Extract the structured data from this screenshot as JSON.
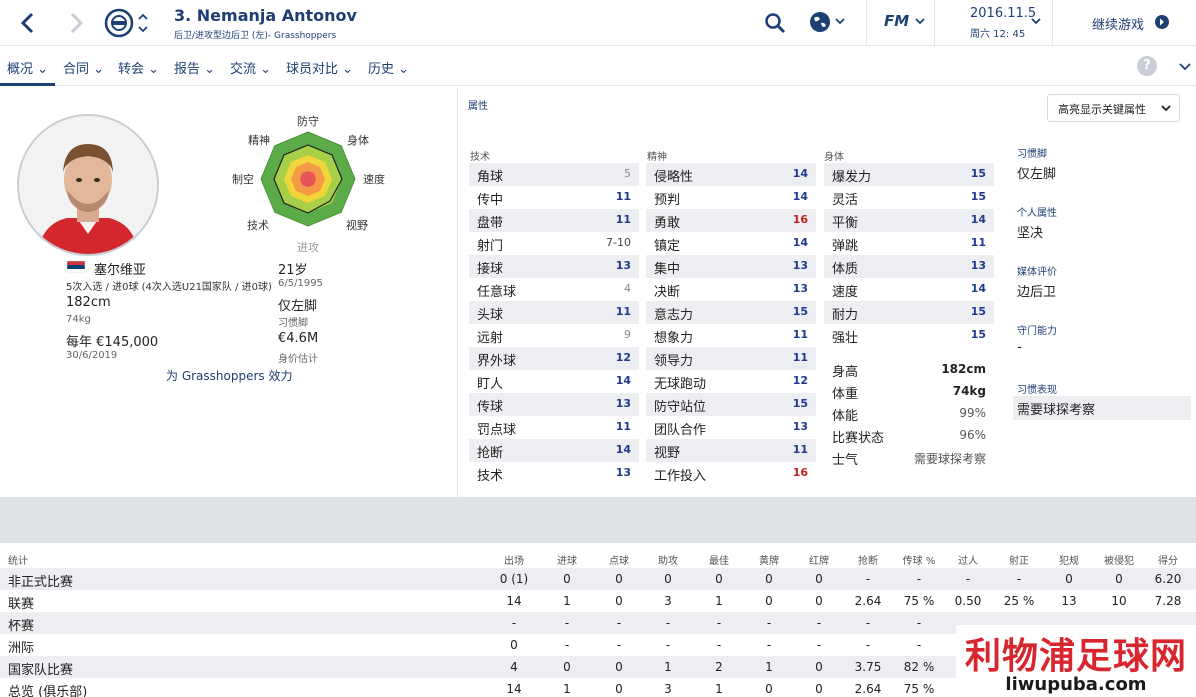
{
  "header": {
    "player_name": "3. Nemanja Antonov",
    "subtitle": "后卫/进攻型边后卫 (左)- Grasshoppers",
    "game_logo": "FM",
    "date": "2016.11.5",
    "time": "周六 12: 45",
    "continue_label": "继续游戏"
  },
  "nav": {
    "tabs": [
      "概况",
      "合同",
      "转会",
      "报告",
      "交流",
      "球员对比",
      "历史"
    ],
    "help": "?"
  },
  "profile": {
    "nationality": "塞尔维亚",
    "caps": "5次入选 / 进0球 (4次入选U21国家队 / 进0球)",
    "age": "21岁",
    "dob": "6/5/1995",
    "height": "182cm",
    "weight": "74kg",
    "foot": "仅左脚",
    "foot_label": "习惯脚",
    "wage": "每年 €145,000",
    "contract_end": "30/6/2019",
    "value": "€4.6M",
    "value_label": "身价估计",
    "club_line": "为 Grasshoppers 效力"
  },
  "radar": {
    "labels": [
      "防守",
      "身体",
      "速度",
      "视野",
      "进攻",
      "技术",
      "制空",
      "精神"
    ]
  },
  "attributes": {
    "section_title": "属性",
    "highlight_select": "高亮显示关键属性",
    "technical_title": "技术",
    "mental_title": "精神",
    "physical_title": "身体",
    "technical": [
      {
        "name": "角球",
        "value": "5",
        "tone": "grey"
      },
      {
        "name": "传中",
        "value": "11",
        "tone": "blue"
      },
      {
        "name": "盘带",
        "value": "11",
        "tone": "blue"
      },
      {
        "name": "射门",
        "value": "7-10",
        "tone": "plain"
      },
      {
        "name": "接球",
        "value": "13",
        "tone": "blue"
      },
      {
        "name": "任意球",
        "value": "4",
        "tone": "grey"
      },
      {
        "name": "头球",
        "value": "11",
        "tone": "blue"
      },
      {
        "name": "远射",
        "value": "9",
        "tone": "grey"
      },
      {
        "name": "界外球",
        "value": "12",
        "tone": "blue"
      },
      {
        "name": "盯人",
        "value": "14",
        "tone": "blue"
      },
      {
        "name": "传球",
        "value": "13",
        "tone": "blue"
      },
      {
        "name": "罚点球",
        "value": "11",
        "tone": "blue"
      },
      {
        "name": "抢断",
        "value": "14",
        "tone": "blue"
      },
      {
        "name": "技术",
        "value": "13",
        "tone": "blue"
      }
    ],
    "mental": [
      {
        "name": "侵略性",
        "value": "14",
        "tone": "blue"
      },
      {
        "name": "预判",
        "value": "14",
        "tone": "blue"
      },
      {
        "name": "勇敢",
        "value": "16",
        "tone": "red"
      },
      {
        "name": "镇定",
        "value": "14",
        "tone": "blue"
      },
      {
        "name": "集中",
        "value": "13",
        "tone": "blue"
      },
      {
        "name": "决断",
        "value": "13",
        "tone": "blue"
      },
      {
        "name": "意志力",
        "value": "15",
        "tone": "blue"
      },
      {
        "name": "想象力",
        "value": "11",
        "tone": "blue"
      },
      {
        "name": "领导力",
        "value": "11",
        "tone": "blue"
      },
      {
        "name": "无球跑动",
        "value": "12",
        "tone": "blue"
      },
      {
        "name": "防守站位",
        "value": "15",
        "tone": "blue"
      },
      {
        "name": "团队合作",
        "value": "13",
        "tone": "blue"
      },
      {
        "name": "视野",
        "value": "11",
        "tone": "blue"
      },
      {
        "name": "工作投入",
        "value": "16",
        "tone": "red"
      }
    ],
    "physical": [
      {
        "name": "爆发力",
        "value": "15",
        "tone": "blue"
      },
      {
        "name": "灵活",
        "value": "15",
        "tone": "blue"
      },
      {
        "name": "平衡",
        "value": "14",
        "tone": "blue"
      },
      {
        "name": "弹跳",
        "value": "11",
        "tone": "blue"
      },
      {
        "name": "体质",
        "value": "13",
        "tone": "blue"
      },
      {
        "name": "速度",
        "value": "14",
        "tone": "blue"
      },
      {
        "name": "耐力",
        "value": "15",
        "tone": "blue"
      },
      {
        "name": "强壮",
        "value": "15",
        "tone": "blue"
      }
    ],
    "extra": [
      {
        "name": "身高",
        "value": "182cm",
        "bold": true
      },
      {
        "name": "体重",
        "value": "74kg",
        "bold": true
      },
      {
        "name": "体能",
        "value": "99%",
        "bold": false
      },
      {
        "name": "比赛状态",
        "value": "96%",
        "bold": false
      },
      {
        "name": "士气",
        "value": "需要球探考察",
        "bold": false
      }
    ]
  },
  "info_panel": [
    {
      "label": "习惯脚",
      "value": "仅左脚"
    },
    {
      "label": "个人属性",
      "value": "坚决"
    },
    {
      "label": "媒体评价",
      "value": "边后卫"
    },
    {
      "label": "守门能力",
      "value": "-"
    },
    {
      "label": "习惯表现",
      "value": "需要球探考察"
    }
  ],
  "stats": {
    "title": "统计",
    "columns": [
      "出场",
      "进球",
      "点球",
      "助攻",
      "最佳",
      "黄牌",
      "红牌",
      "抢断",
      "传球 %",
      "过人",
      "射正",
      "犯规",
      "被侵犯",
      "得分"
    ],
    "rows": [
      {
        "name": "非正式比赛",
        "values": [
          "0 (1)",
          "0",
          "0",
          "0",
          "0",
          "0",
          "0",
          "-",
          "-",
          "-",
          "-",
          "0",
          "0",
          "6.20"
        ]
      },
      {
        "name": "联赛",
        "values": [
          "14",
          "1",
          "0",
          "3",
          "1",
          "0",
          "0",
          "2.64",
          "75 %",
          "0.50",
          "25 %",
          "13",
          "10",
          "7.28"
        ]
      },
      {
        "name": "杯赛",
        "values": [
          "-",
          "-",
          "-",
          "-",
          "-",
          "-",
          "-",
          "-",
          "-",
          "",
          "",
          "",
          "",
          ""
        ]
      },
      {
        "name": "洲际",
        "values": [
          "0",
          "-",
          "-",
          "-",
          "-",
          "-",
          "-",
          "-",
          "-",
          "",
          "",
          "",
          "",
          ""
        ]
      },
      {
        "name": "国家队比赛",
        "values": [
          "4",
          "0",
          "0",
          "1",
          "2",
          "1",
          "0",
          "3.75",
          "82 %",
          "",
          "",
          "",
          "",
          ""
        ]
      },
      {
        "name": "总览 (俱乐部)",
        "values": [
          "14",
          "1",
          "0",
          "3",
          "1",
          "0",
          "0",
          "2.64",
          "75 %",
          "",
          "",
          "",
          "",
          ""
        ]
      }
    ]
  },
  "watermark": {
    "text": "利物浦足球网",
    "url": "liwupuba.com"
  },
  "colors": {
    "navy": "#1d3f73",
    "attr_blue": "#1f3a8f",
    "attr_red": "#c4231b",
    "watermark_red": "#d8262e"
  }
}
